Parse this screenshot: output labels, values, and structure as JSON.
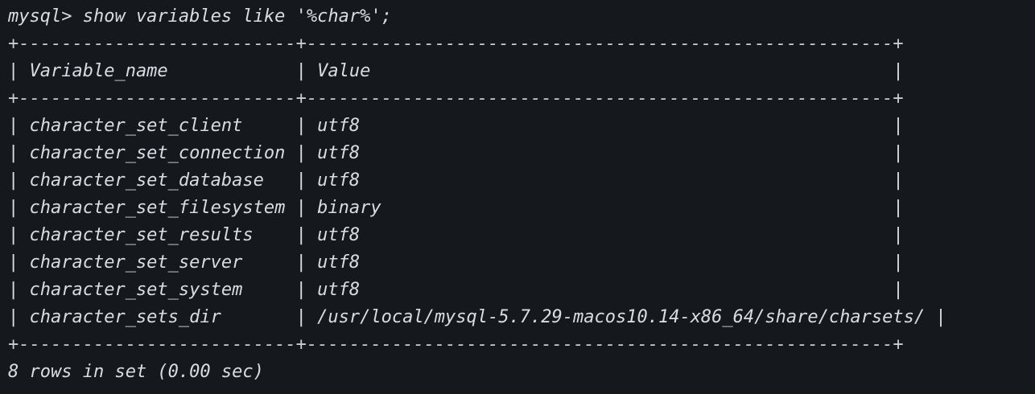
{
  "terminal": {
    "command": "mysql> show variables like '%char%';",
    "border_line": "+--------------------------+-------------------------------------------------------+",
    "header_line": "| Variable_name            | Value                                                 |",
    "rows": [
      "| character_set_client     | utf8                                                  |",
      "| character_set_connection | utf8                                                  |",
      "| character_set_database   | utf8                                                  |",
      "| character_set_filesystem | binary                                                |",
      "| character_set_results    | utf8                                                  |",
      "| character_set_server     | utf8                                                  |",
      "| character_set_system     | utf8                                                  |",
      "| character_sets_dir       | /usr/local/mysql-5.7.29-macos10.14-x86_64/share/charsets/ |"
    ],
    "footer": "8 rows in set (0.00 sec)"
  },
  "colors": {
    "background": "#15181d",
    "text": "#d9dde3"
  }
}
